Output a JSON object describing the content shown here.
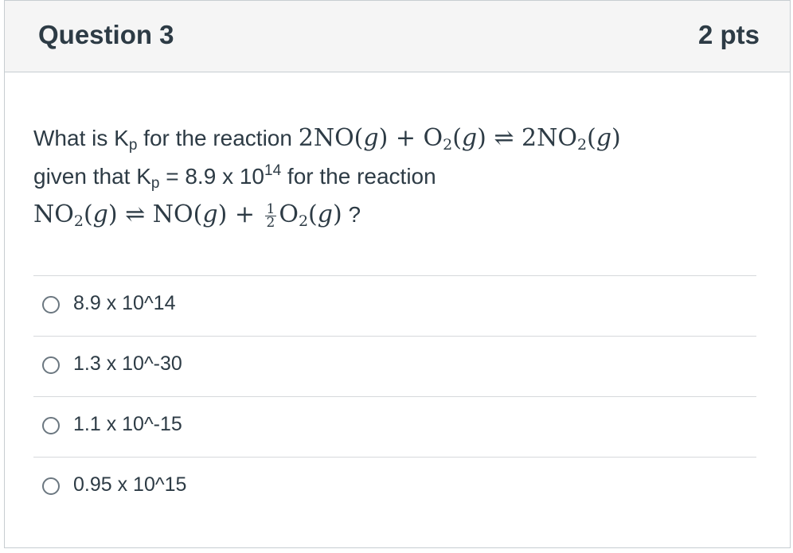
{
  "question": {
    "title": "Question 3",
    "points": "2 pts",
    "line1": {
      "prefix": "What is K",
      "k_sub": "p",
      "middle": " for the reaction ",
      "coef1": "2NO(",
      "var_g": "g",
      "after_g1": ") + O",
      "o2_sub": "2",
      "paren_g2_open": "(",
      "paren_g2_close": ") ⇌ 2NO",
      "no2_sub": "2",
      "paren_g3": "(",
      "paren_g3_close": ")"
    },
    "line2": {
      "prefix": "given that K",
      "k_sub": "p",
      "value": " = 8.9 x 10",
      "exponent": "14",
      "suffix": " for the reaction"
    },
    "line3": {
      "no": "NO",
      "no_sub": "2",
      "paren1_open": "(",
      "paren1_close": ") ⇌ NO(",
      "paren2_close": ") + ",
      "frac_num": "1",
      "frac_den": "2",
      "o": "O",
      "o_sub": "2",
      "paren3_open": "(",
      "paren3_close": ")",
      "question_mark": " ?"
    }
  },
  "answers": [
    {
      "label": "8.9 x 10^14"
    },
    {
      "label": "1.3 x 10^-30"
    },
    {
      "label": "1.1 x 10^-15"
    },
    {
      "label": "0.95 x 10^15"
    }
  ]
}
